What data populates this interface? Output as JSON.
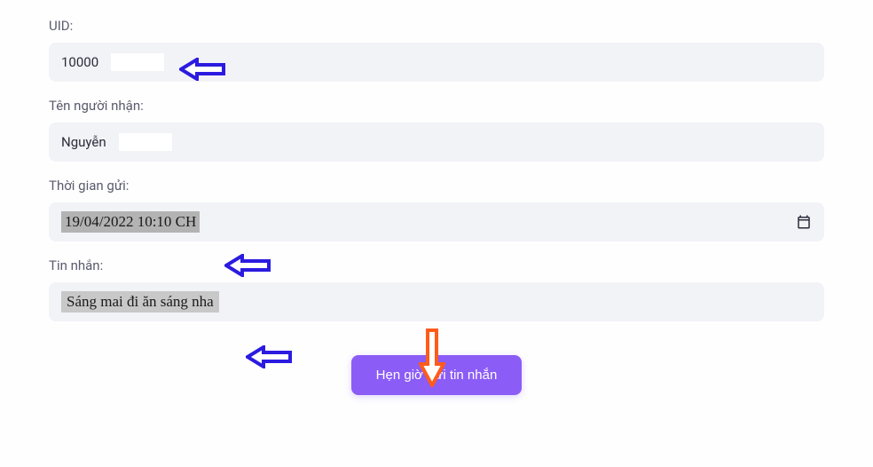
{
  "form": {
    "uid": {
      "label": "UID:",
      "value": "10000"
    },
    "recipient": {
      "label": "Tên người nhận:",
      "value": "Nguyễn"
    },
    "time": {
      "label": "Thời gian gửi:",
      "value": "19/04/2022  10:10 CH"
    },
    "message": {
      "label": "Tin nhắn:",
      "value": "Sáng mai đi ăn sáng nha"
    },
    "submit_label": "Hẹn giờ gửi tin nhắn"
  },
  "colors": {
    "accent": "#8b5cf6",
    "arrow_blue": "#2b1be0",
    "arrow_orange": "#ff5b1a"
  }
}
